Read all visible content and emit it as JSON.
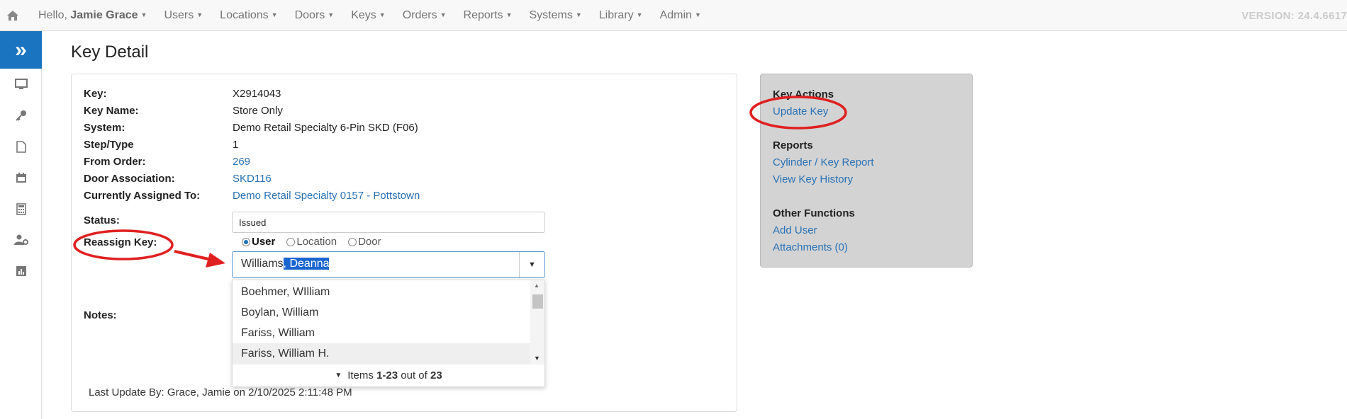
{
  "nav": {
    "greeting": "Hello,",
    "user_name": "Jamie Grace",
    "items": [
      "Users",
      "Locations",
      "Doors",
      "Keys",
      "Orders",
      "Reports",
      "Systems",
      "Library",
      "Admin"
    ],
    "version": "VERSION: 24.4.6617"
  },
  "page": {
    "title": "Key Detail"
  },
  "details": [
    {
      "label": "Key:",
      "value": "X2914043"
    },
    {
      "label": "Key Name:",
      "value": "Store Only"
    },
    {
      "label": "System:",
      "value": "Demo Retail Specialty 6-Pin SKD (F06)"
    },
    {
      "label": "Step/Type",
      "value": "1"
    },
    {
      "label": "From Order:",
      "value": "269"
    },
    {
      "label": "Door Association:",
      "value": "SKD116"
    },
    {
      "label": "Currently Assigned To:",
      "value": "Demo Retail Specialty 0157 - Pottstown"
    }
  ],
  "status": {
    "label": "Status:",
    "value": "Issued"
  },
  "reassign": {
    "label": "Reassign Key:",
    "options": [
      "User",
      "Location",
      "Door"
    ],
    "selected": "User",
    "typed": "William",
    "typed_tail": "s",
    "autocomplete_selected": ", Deanna"
  },
  "dropdown": {
    "items": [
      "Boehmer, WIlliam",
      "Boylan, William",
      "Fariss, William",
      "Fariss, William H."
    ],
    "hovered_index": 3,
    "footer_prefix": "Items",
    "footer_range": "1-23",
    "footer_mid": "out of",
    "footer_total": "23"
  },
  "notes": {
    "label": "Notes:"
  },
  "last_update": "Last Update By: Grace, Jamie on 2/10/2025 2:11:48 PM",
  "side": {
    "key_actions_title": "Key Actions",
    "update_key": "Update Key",
    "reports_title": "Reports",
    "cylinder_report": "Cylinder / Key Report",
    "view_history": "View Key History",
    "other_title": "Other Functions",
    "add_user": "Add User",
    "attachments": "Attachments (0)"
  },
  "colors": {
    "accent": "#1a74c0",
    "link": "#2a72b5",
    "annotation": "#e02020"
  }
}
